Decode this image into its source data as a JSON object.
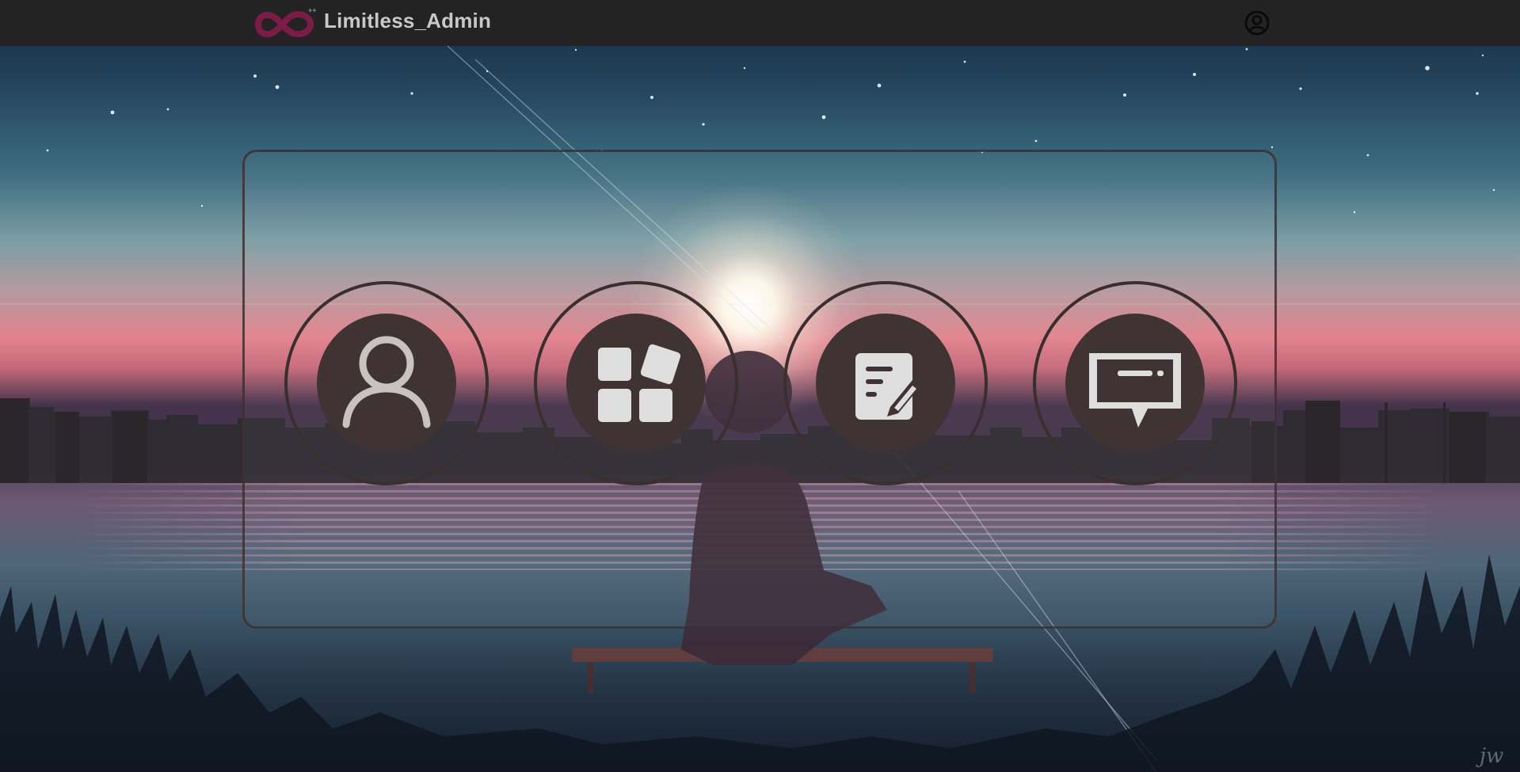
{
  "app": {
    "title": "Limitless_Admin",
    "logo_icon": "infinity-logo-icon",
    "logo_color": "#7a1c45",
    "account_icon": "user-circle-icon"
  },
  "colors": {
    "topbar_bg": "#232323",
    "tile_fill": "#3f3333",
    "tile_ring": "#3a2f2f",
    "icon_fill": "#c9c2c2"
  },
  "tiles": [
    {
      "icon": "user-icon"
    },
    {
      "icon": "dashboard-grid-icon"
    },
    {
      "icon": "edit-document-icon"
    },
    {
      "icon": "message-icon"
    }
  ],
  "signature": "jw"
}
